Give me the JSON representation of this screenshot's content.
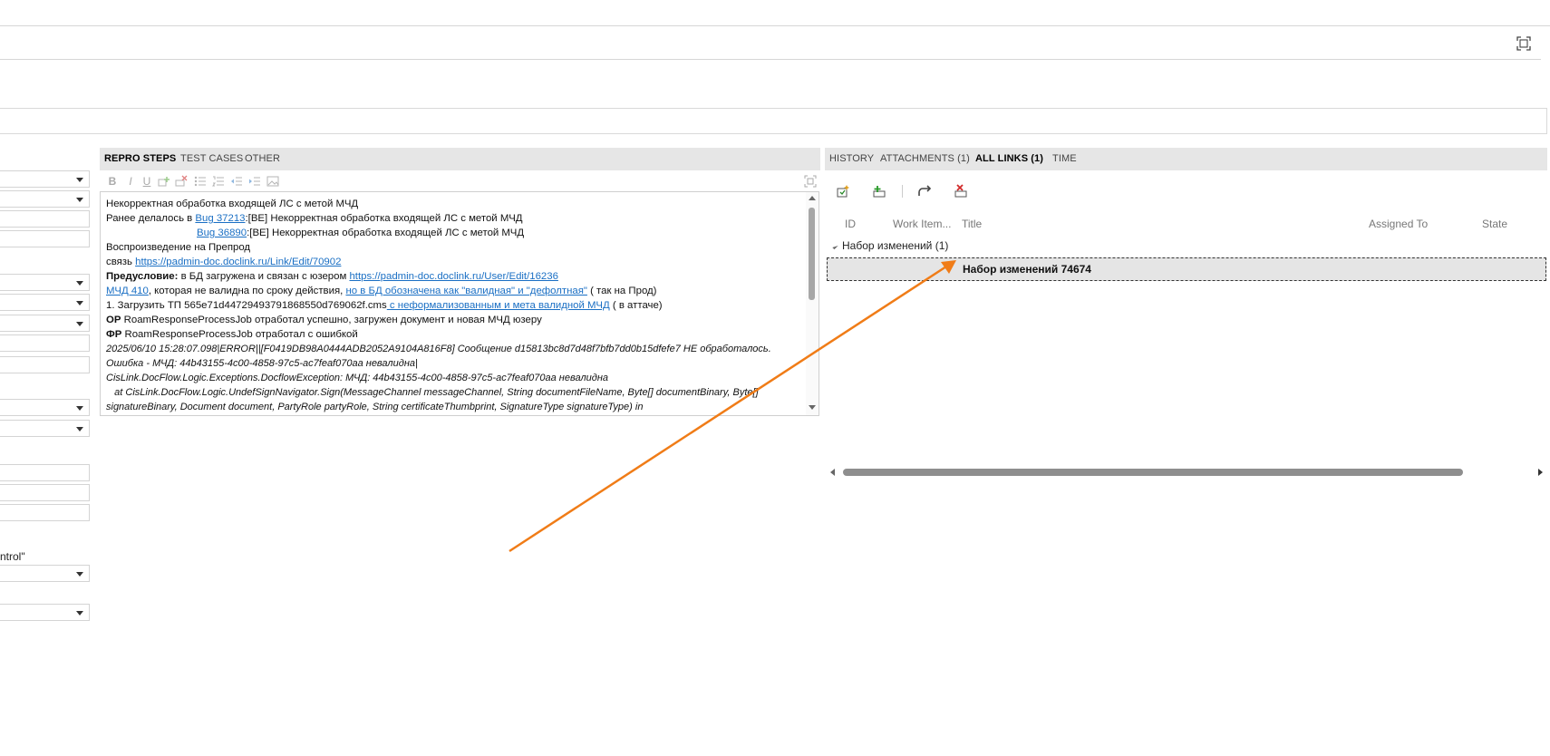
{
  "top_right_icon": "fullscreen-icon",
  "left_fields": {
    "partial_text": "ntrol\""
  },
  "left_tabs": [
    {
      "label": "REPRO STEPS",
      "active": true
    },
    {
      "label": "TEST CASES",
      "active": false
    },
    {
      "label": "OTHER",
      "active": false
    }
  ],
  "editor_toolbar_icons": [
    "bold-icon",
    "italic-icon",
    "underline-icon",
    "insert-image-icon",
    "clear-format-icon",
    "bullet-list-icon",
    "numbered-list-icon",
    "decrease-indent-icon",
    "increase-indent-icon",
    "image-icon"
  ],
  "editor": {
    "l1": "Некорректная обработка входящей ЛС с метой МЧД",
    "l2_pre": "Ранее делалось в ",
    "l2_link": "Bug 37213",
    "l2_post": ":[BE] Некорректная обработка входящей ЛС с метой МЧД",
    "l3_link": "Bug 36890",
    "l3_post": ":[BE] Некорректная обработка входящей ЛС с метой МЧД",
    "l4": "Воспроизведение на Препрод",
    "l5_pre": "связь ",
    "l5_link": "https://padmin-doc.doclink.ru/Link/Edit/70902",
    "l6_bold": "Предусловие:",
    "l6_mid": " в БД загружена и связан с юзером ",
    "l6_link": "https://padmin-doc.doclink.ru/User/Edit/16236",
    "l7_link1": "МЧД 410",
    "l7_mid": ", которая не валидна по сроку действия, ",
    "l7_link2": "но в БД обозначена как \"валидная\" и \"дефолтная\"",
    "l7_post": " ( так на Прод)",
    "l8_pre": "1. Загрузить ТП 565e71d44729493791868550d769062f.cms",
    "l8_link": " с неформализованным и мета валидной МЧД",
    "l8_post": " ( в аттаче)",
    "l9_bold": "ОР",
    "l9_text": " RoamResponseProcessJob отработал успешно, загружен документ и новая МЧД юзеру",
    "l10_bold": "ФР",
    "l10_text": " RoamResponseProcessJob отработал с ошибкой",
    "l11": "2025/06/10 15:28:07.098|ERROR||[F0419DB98A0444ADB2052A9104A816F8] Сообщение d15813bc8d7d48f7bfb7dd0b15dfefe7 НЕ обработалось.",
    "l12": "Ошибка - МЧД: 44b43155-4c00-4858-97c5-ac7feaf070aa невалидна|",
    "l13": "CisLink.DocFlow.Logic.Exceptions.DocflowException: МЧД: 44b43155-4c00-4858-97c5-ac7feaf070aa невалидна",
    "l14": "   at CisLink.DocFlow.Logic.UndefSignNavigator.Sign(MessageChannel messageChannel, String documentFileName, Byte[] documentBinary, Byte[]",
    "l15": "signatureBinary, Document document, PartyRole partyRole, String certificateThumbprint, SignatureType signatureType) in"
  },
  "right_tabs": [
    {
      "label": "HISTORY",
      "active": false
    },
    {
      "label": "ATTACHMENTS (1)",
      "active": false
    },
    {
      "label": "ALL LINKS (1)",
      "active": true
    },
    {
      "label": "TIME",
      "active": false
    }
  ],
  "links_toolbar_icons": [
    "new-linked-item-icon",
    "add-link-icon",
    "open-link-icon",
    "delete-link-icon"
  ],
  "links_columns": [
    "ID",
    "Work Item...",
    "Title",
    "Assigned To",
    "State"
  ],
  "links_group": {
    "label": "Набор изменений (1)"
  },
  "links_rows": [
    {
      "title": "Набор изменений 74674"
    }
  ],
  "colors": {
    "tab_bar": "#e6e6e6",
    "link": "#1a6fc4",
    "arrow": "#f07c17",
    "selected_row": "#e5e5e5"
  }
}
